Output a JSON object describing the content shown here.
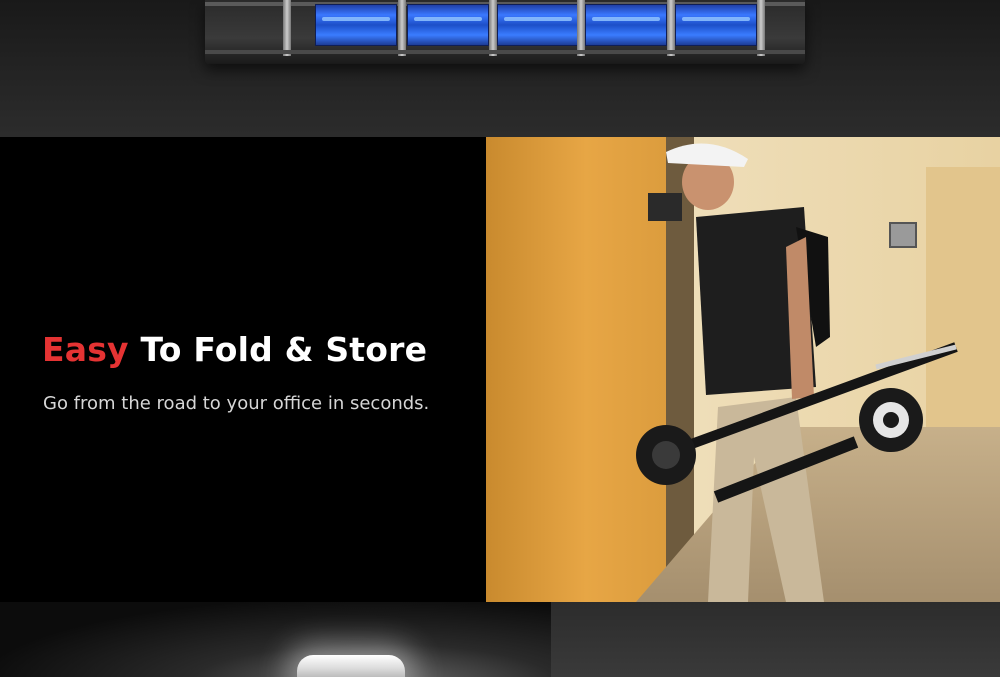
{
  "hero": {
    "title_accent": "Easy",
    "title_rest": "To Fold & Store",
    "subtitle": "Go from the road to your office in seconds."
  },
  "colors": {
    "accent": "#e53333",
    "title": "#ffffff",
    "subtitle": "#d6d6d6",
    "battery_blue": "#3a78ff"
  }
}
